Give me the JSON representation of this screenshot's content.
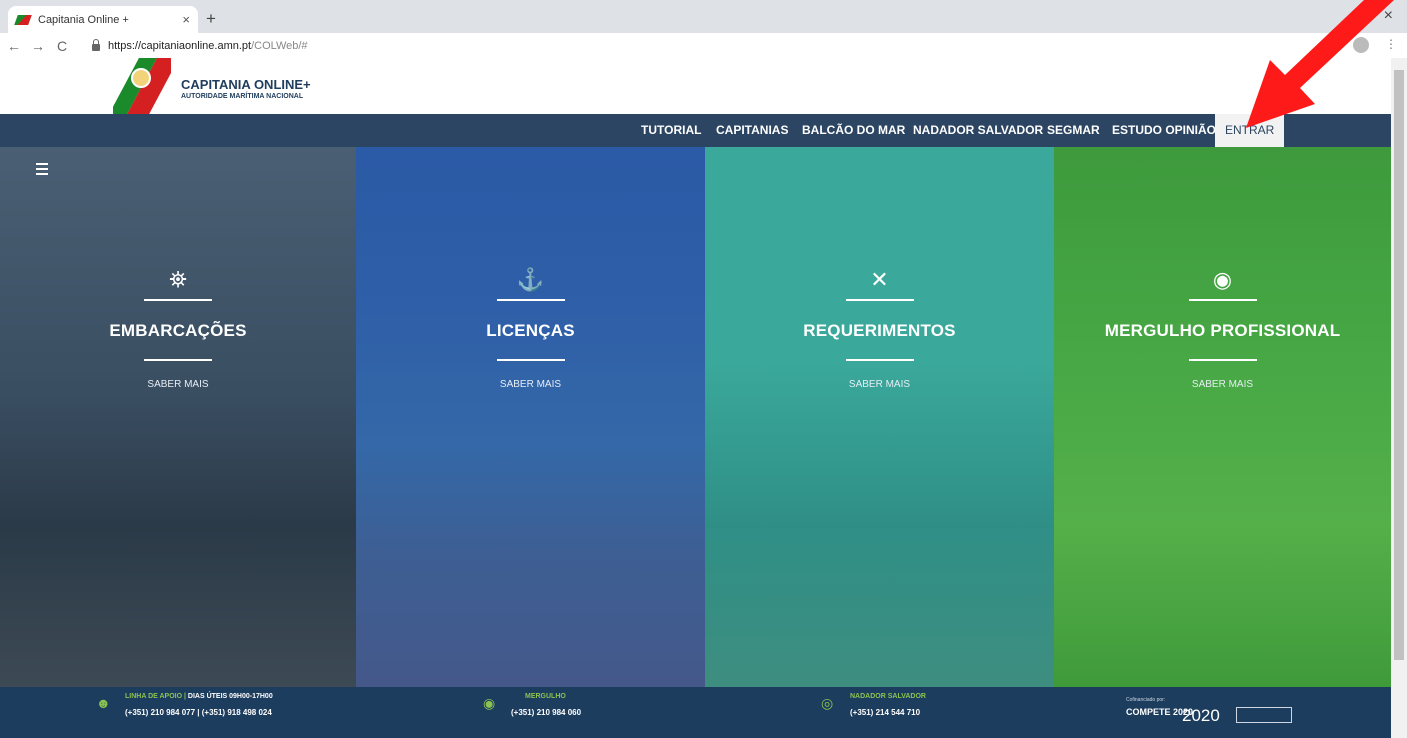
{
  "browser": {
    "tab_title": "Capitania Online +",
    "tab_close": "×",
    "new_tab": "+",
    "window_close": "×",
    "url_host": "https://capitaniaonline.amn.pt",
    "url_path": "/COLWeb/#",
    "back": "←",
    "forward": "→",
    "reload": "C",
    "star": "☆",
    "menu": "⋮"
  },
  "header": {
    "title": "CAPITANIA ONLINE+",
    "subtitle": "AUTORIDADE MARÍTIMA NACIONAL"
  },
  "nav": {
    "items": [
      "TUTORIAL",
      "CAPITANIAS",
      "BALCÃO DO MAR",
      "NADADOR SALVADOR",
      "SEGMAR",
      "ESTUDO OPINIÃO",
      "ENTRAR"
    ]
  },
  "tiles": [
    {
      "title": "EMBARCAÇÕES",
      "more": "SABER MAIS",
      "icon": "ship-wheel-icon",
      "glyph": "⛯",
      "color": "#34495e"
    },
    {
      "title": "LICENÇAS",
      "more": "SABER MAIS",
      "icon": "anchor-icon",
      "glyph": "⚓",
      "color": "#1f4e9c"
    },
    {
      "title": "REQUERIMENTOS",
      "more": "SABER MAIS",
      "icon": "crossed-tools-icon",
      "glyph": "✕",
      "color": "#1f9e8f"
    },
    {
      "title": "MERGULHO PROFISSIONAL",
      "more": "SABER MAIS",
      "icon": "diving-helmet-icon",
      "glyph": "◉",
      "color": "#3cab3c"
    }
  ],
  "footer": {
    "support_label": "LINHA DE APOIO",
    "support_hours": "DIAS ÚTEIS 09H00-17H00",
    "support_phones": "(+351) 210 984 077 | (+351) 918 498 024",
    "diving_label": "MERGULHO",
    "diving_phone": "(+351) 210 984 060",
    "lifeguard_label": "NADADOR SALVADOR",
    "lifeguard_phone": "(+351) 214 544 710",
    "cofin": "Cofinanciado por:",
    "compete": "COMPETE 2020",
    "p2020": "2020"
  },
  "colors": {
    "nav_bg": "#2b4562",
    "footer_bg": "#1d3d5e",
    "accent_green": "#8cc152",
    "arrow": "#ff1a1a"
  }
}
